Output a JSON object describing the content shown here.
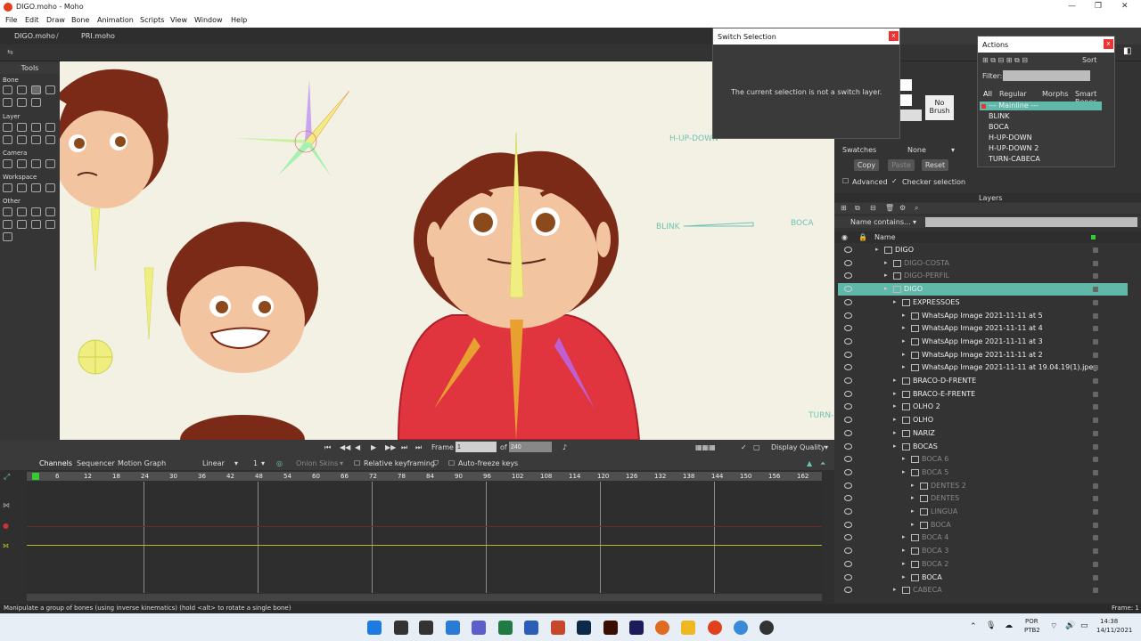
{
  "app": {
    "window_title": "DIGO.moho - Moho",
    "menus": [
      "File",
      "Edit",
      "Draw",
      "Bone",
      "Animation",
      "Scripts",
      "View",
      "Window",
      "Help"
    ],
    "doc_tabs": [
      "DIGO.moho",
      "PRI.moho"
    ]
  },
  "tools": {
    "title": "Tools",
    "sections": [
      "Bone",
      "Layer",
      "Camera",
      "Workspace",
      "Other"
    ]
  },
  "canvas": {
    "labels": {
      "h_up_down": "H-UP-DOWN",
      "blink": "BLINK",
      "boca": "BOCA",
      "turn": "TURN-"
    }
  },
  "canvas_bar": {
    "frame_label": "Frame",
    "frame_value": "1",
    "of_label": "of",
    "end_frame": "240",
    "display_quality": "Display Quality"
  },
  "timeline": {
    "tabs": [
      "Channels",
      "Sequencer",
      "Motion Graph"
    ],
    "interpolation": "Linear",
    "interp_step": "1",
    "onion_skins": "Onion Skins",
    "relative_keyframing": "Relative keyframing",
    "auto_freeze": "Auto-freeze keys",
    "ruler": [
      "6",
      "12",
      "18",
      "24",
      "30",
      "36",
      "42",
      "48",
      "54",
      "60",
      "66",
      "72",
      "78",
      "84",
      "90",
      "96",
      "102",
      "108",
      "114",
      "120",
      "126",
      "132",
      "138",
      "144",
      "150",
      "156",
      "162"
    ]
  },
  "switch_dialog": {
    "title": "Switch Selection",
    "message": "The current selection is not a switch layer."
  },
  "actions_dialog": {
    "title": "Actions",
    "sort": "Sort",
    "filter_label": "Filter:",
    "tabs": [
      "All",
      "Regular",
      "Morphs",
      "Smart Bones"
    ],
    "items": [
      "--- Mainline ---",
      "BLINK",
      "BOCA",
      "H-UP-DOWN",
      "H-UP-DOWN 2",
      "TURN-CABECA"
    ]
  },
  "style_panel": {
    "no_brush": "No\nBrush",
    "swatches_label": "Swatches",
    "swatches_value": "None",
    "copy": "Copy",
    "paste": "Paste",
    "reset": "Reset",
    "advanced": "Advanced",
    "checker_selection": "Checker selection"
  },
  "layers": {
    "title": "Layers",
    "filter_mode": "Name contains...",
    "name_header": "Name",
    "rows": [
      {
        "name": "DIGO",
        "indent": 0,
        "dim": false,
        "selected": false
      },
      {
        "name": "DIGO-COSTA",
        "indent": 1,
        "dim": true,
        "selected": false
      },
      {
        "name": "DIGO-PERFIL",
        "indent": 1,
        "dim": true,
        "selected": false
      },
      {
        "name": "DIGO",
        "indent": 1,
        "dim": false,
        "selected": true
      },
      {
        "name": "EXPRESSOES",
        "indent": 2,
        "dim": false,
        "selected": false
      },
      {
        "name": "WhatsApp Image 2021-11-11 at 5",
        "indent": 3,
        "dim": false,
        "selected": false
      },
      {
        "name": "WhatsApp Image 2021-11-11 at 4",
        "indent": 3,
        "dim": false,
        "selected": false
      },
      {
        "name": "WhatsApp Image 2021-11-11 at 3",
        "indent": 3,
        "dim": false,
        "selected": false
      },
      {
        "name": "WhatsApp Image 2021-11-11 at 2",
        "indent": 3,
        "dim": false,
        "selected": false
      },
      {
        "name": "WhatsApp Image 2021-11-11 at 19.04.19(1).jpeg",
        "indent": 3,
        "dim": false,
        "selected": false
      },
      {
        "name": "BRACO-D-FRENTE",
        "indent": 2,
        "dim": false,
        "selected": false
      },
      {
        "name": "BRACO-E-FRENTE",
        "indent": 2,
        "dim": false,
        "selected": false
      },
      {
        "name": "OLHO 2",
        "indent": 2,
        "dim": false,
        "selected": false
      },
      {
        "name": "OLHO",
        "indent": 2,
        "dim": false,
        "selected": false
      },
      {
        "name": "NARIZ",
        "indent": 2,
        "dim": false,
        "selected": false
      },
      {
        "name": "BOCAS",
        "indent": 2,
        "dim": false,
        "selected": false
      },
      {
        "name": "BOCA 6",
        "indent": 3,
        "dim": true,
        "selected": false
      },
      {
        "name": "BOCA 5",
        "indent": 3,
        "dim": true,
        "selected": false
      },
      {
        "name": "DENTES 2",
        "indent": 4,
        "dim": true,
        "selected": false
      },
      {
        "name": "DENTES",
        "indent": 4,
        "dim": true,
        "selected": false
      },
      {
        "name": "LINGUA",
        "indent": 4,
        "dim": true,
        "selected": false
      },
      {
        "name": "BOCA",
        "indent": 4,
        "dim": true,
        "selected": false
      },
      {
        "name": "BOCA 4",
        "indent": 3,
        "dim": true,
        "selected": false
      },
      {
        "name": "BOCA 3",
        "indent": 3,
        "dim": true,
        "selected": false
      },
      {
        "name": "BOCA 2",
        "indent": 3,
        "dim": true,
        "selected": false
      },
      {
        "name": "BOCA",
        "indent": 3,
        "dim": false,
        "selected": false
      },
      {
        "name": "CABECA",
        "indent": 2,
        "dim": true,
        "selected": false
      }
    ]
  },
  "status": {
    "message": "Manipulate a group of bones (using inverse kinematics) (hold <alt> to rotate a single bone)",
    "frame": "Frame: 1"
  },
  "taskbar": {
    "lang1": "POR",
    "lang2": "PTB2",
    "time": "14:38",
    "date": "14/11/2021"
  },
  "colors": {
    "accent": "#6fc3b4",
    "selected_row": "#5fb8a8",
    "canvas_bg": "#f3f1e3"
  }
}
